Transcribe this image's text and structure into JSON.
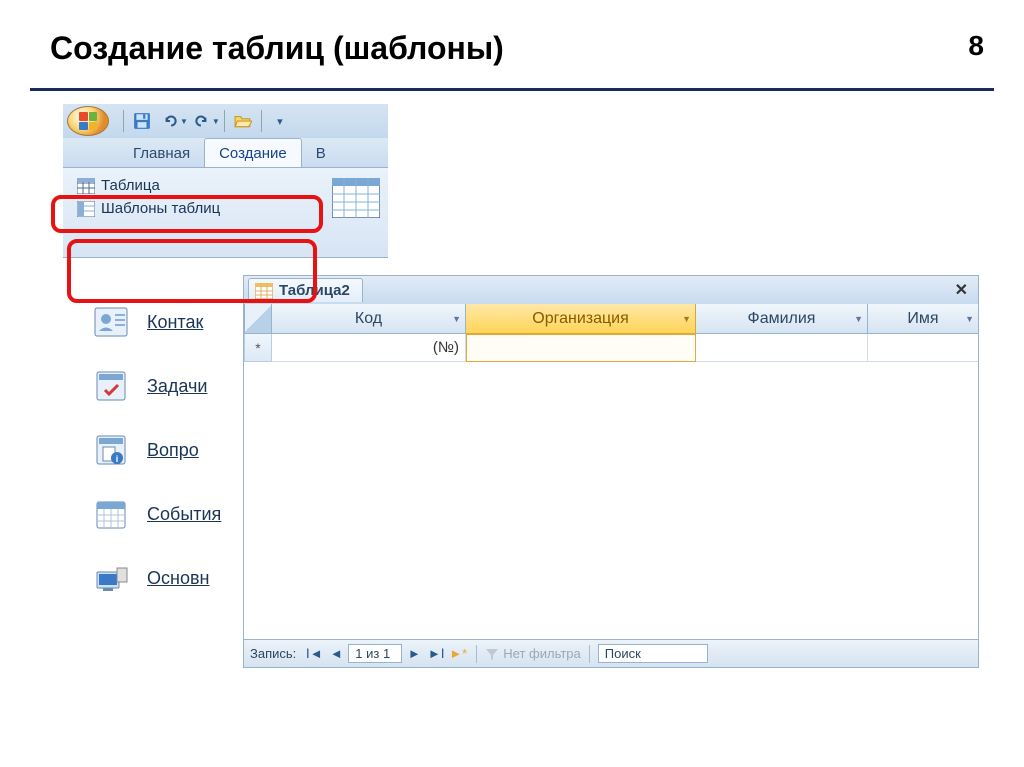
{
  "slide": {
    "title": "Создание таблиц (шаблоны)",
    "number": "8"
  },
  "ribbon": {
    "tabs": {
      "home": "Главная",
      "create": "Создание",
      "partial": "В"
    },
    "items": {
      "table": "Таблица",
      "templates": "Шаблоны таблиц"
    }
  },
  "templates_menu": {
    "contacts": "Контак",
    "tasks": "Задачи",
    "questions": "Вопро",
    "events": "События",
    "main": "Основн"
  },
  "table_view": {
    "tab_title": "Таблица2",
    "columns": [
      "Код",
      "Организация",
      "Фамилия",
      "Имя"
    ],
    "new_row": {
      "id_placeholder": "(№)",
      "org_value": ""
    }
  },
  "nav": {
    "label": "Запись:",
    "position": "1 из 1",
    "no_filter": "Нет фильтра",
    "search": "Поиск"
  },
  "col_widths": {
    "id": 194,
    "org": 230,
    "lastname": 172,
    "name": 110
  }
}
